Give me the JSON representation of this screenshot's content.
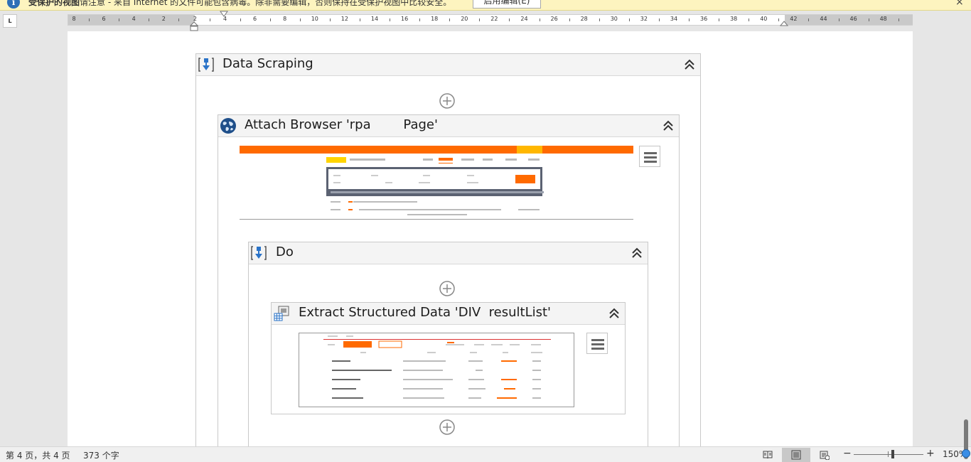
{
  "protected_view": {
    "title": "受保护的视图",
    "message": "请注意 - 来自 Internet 的文件可能包含病毒。除非需要编辑，否则保持在受保护视图中比较安全。",
    "enable_button": "启用编辑(E)",
    "close_glyph": "×"
  },
  "ruler": {
    "tab_glyph": "L",
    "numbers": [
      "8",
      "6",
      "4",
      "2",
      "2",
      "4",
      "6",
      "8",
      "10",
      "12",
      "14",
      "16",
      "18",
      "20",
      "22",
      "24",
      "26",
      "28",
      "30",
      "32",
      "34",
      "36",
      "38",
      "40",
      "42",
      "44",
      "46",
      "48"
    ]
  },
  "workflow": {
    "data_scraping": {
      "title": "Data Scraping",
      "icon": "sequence-icon"
    },
    "attach_browser": {
      "title": "Attach Browser 'rpa        Page'",
      "icon": "globe-icon"
    },
    "do": {
      "title": "Do",
      "icon": "sequence-icon"
    },
    "extract": {
      "title": "Extract Structured Data 'DIV  resultList'",
      "icon": "extract-data-icon"
    }
  },
  "status_bar": {
    "page_info": "第 4 页，共 4 页",
    "word_count": "373 个字",
    "zoom_minus": "−",
    "zoom_plus": "+",
    "zoom_level": "150%"
  },
  "colors": {
    "accent_orange": "#ff6a00",
    "ribbon_yellow": "#fdf4bf",
    "workflow_border": "#c9c9c9",
    "icon_blue": "#2a73c8"
  }
}
